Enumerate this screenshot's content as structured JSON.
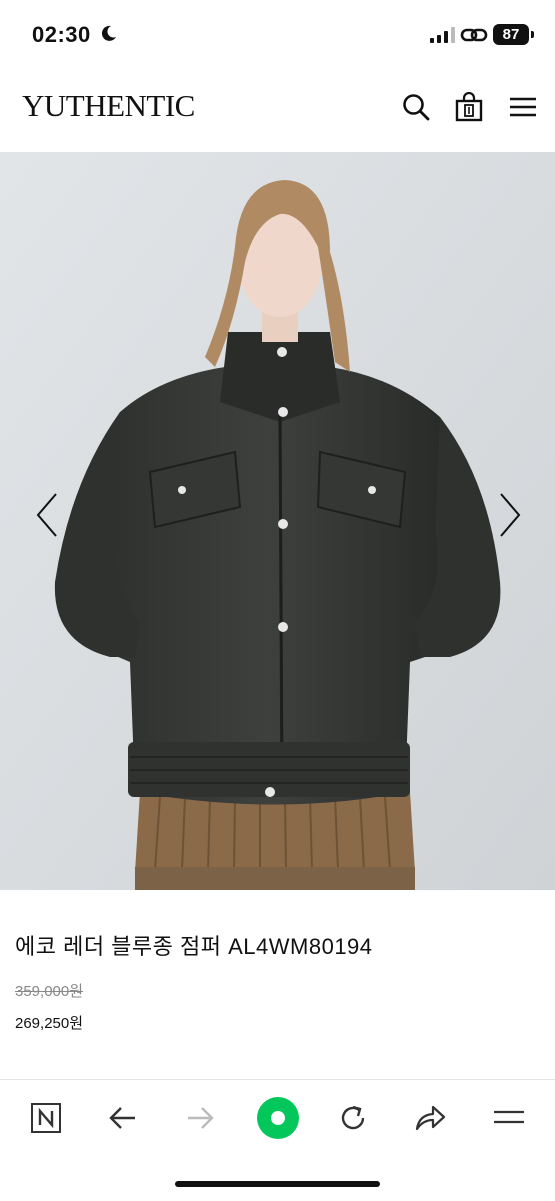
{
  "status_bar": {
    "time": "02:30",
    "battery": "87"
  },
  "header": {
    "logo": "YUTHENTIC",
    "icons": [
      "search-icon",
      "shopping-bag-icon",
      "menu-icon"
    ]
  },
  "product": {
    "title": "에코 레더 블루종 점퍼 AL4WM80194",
    "original_price": "359,000원",
    "sale_price": "269,250원"
  },
  "browser_toolbar": {
    "buttons": [
      "naver-home-icon",
      "back-arrow-icon",
      "forward-arrow-icon",
      "green-circle-icon",
      "reload-icon",
      "share-icon",
      "menu-icon"
    ],
    "accent_color": "#03c75a"
  }
}
